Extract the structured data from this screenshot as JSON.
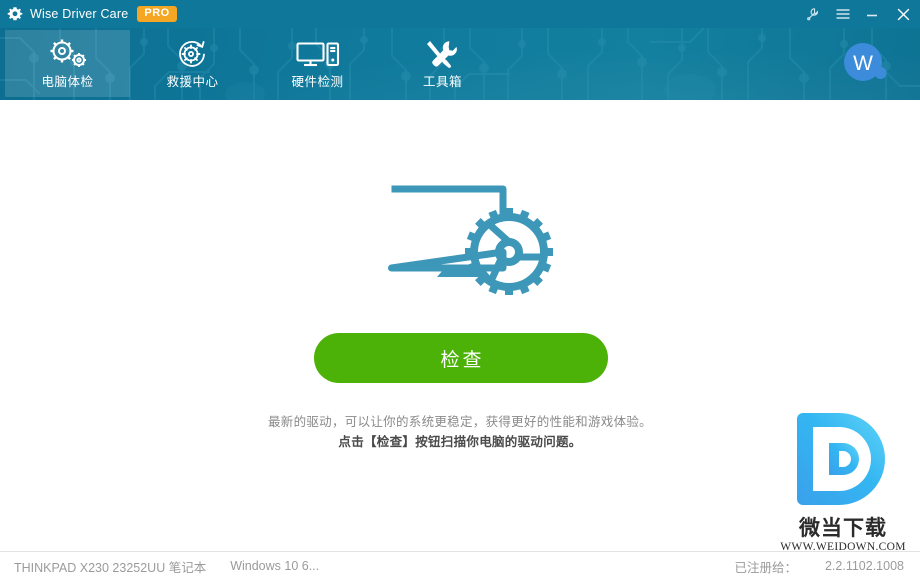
{
  "window": {
    "title": "Wise Driver Care",
    "badge": "PRO",
    "app_icon": "gear-icon",
    "controls": [
      {
        "name": "feedback-wrench-icon",
        "label": "Feedback"
      },
      {
        "name": "menu-hamburger-icon",
        "label": "Menu"
      },
      {
        "name": "minimize-icon",
        "label": "Minimize"
      },
      {
        "name": "close-icon",
        "label": "Close"
      }
    ],
    "accent_color": "#0f7799",
    "badge_color": "#f5a623"
  },
  "header": {
    "background_color": "#107a9c",
    "tabs": [
      {
        "label": "电脑体检",
        "icon": "gears-icon",
        "active": true
      },
      {
        "label": "救援中心",
        "icon": "gear-refresh-icon",
        "active": false
      },
      {
        "label": "硬件检测",
        "icon": "monitor-tower-icon",
        "active": false
      },
      {
        "label": "工具箱",
        "icon": "wrench-screwdriver-icon",
        "active": false
      }
    ],
    "avatar": {
      "initial": "W",
      "color": "#3d8bdb"
    }
  },
  "main": {
    "illustration": "monitor-gear-icon",
    "illustration_color": "#3d97b8",
    "scan_button": {
      "label": "检查",
      "color": "#4cb208"
    },
    "description_line1": "最新的驱动，可以让你的系统更稳定，获得更好的性能和游戏体验。",
    "description_line2": "点击【检查】按钮扫描你电脑的驱动问题。"
  },
  "watermark": {
    "logo": "letter-d-logo",
    "name_cn": "微当下载",
    "url": "WWW.WEIDOWN.COM"
  },
  "statusbar": {
    "device": "THINKPAD X230 23252UU 笔记本",
    "os": "Windows 10 6...",
    "registered_label": "已注册给：",
    "version": "2.2.1102.1008"
  }
}
